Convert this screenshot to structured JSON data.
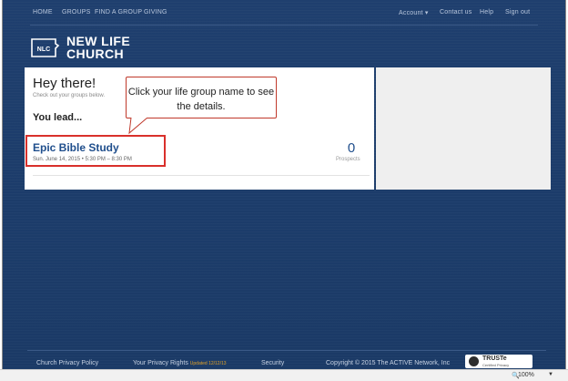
{
  "nav": {
    "left": [
      "HOME",
      "GROUPS",
      "FIND A GROUP",
      "GIVING"
    ],
    "right": [
      "Account ▾",
      "Contact us",
      "Help",
      "Sign out"
    ]
  },
  "logo": {
    "mark": "NLC",
    "line1": "NEW LIFE",
    "line2": "CHURCH"
  },
  "main": {
    "greeting": "Hey there!",
    "subtitle": "Check out your groups below.",
    "section_title": "You lead...",
    "callout": "Click your life group name to see the details.",
    "group": {
      "name": "Epic Bible Study",
      "date": "Sun. June 14, 2015  •  5:30 PM – 8:30 PM",
      "count": "0",
      "count_label": "Prospects"
    }
  },
  "footer": {
    "privacy_policy": "Church Privacy Policy",
    "privacy_rights": "Your Privacy Rights",
    "updated": "Updated 12/12/13",
    "security": "Security",
    "copyright": "Copyright © 2015 The ACTIVE Network, Inc",
    "truste": "TRUSTe",
    "truste_sub": "Certified Privacy"
  },
  "statusbar": {
    "zoom": "100%"
  },
  "colors": {
    "nav_bg": "#1f3f6e",
    "link": "#1f4e8c",
    "highlight": "#d9302b"
  }
}
